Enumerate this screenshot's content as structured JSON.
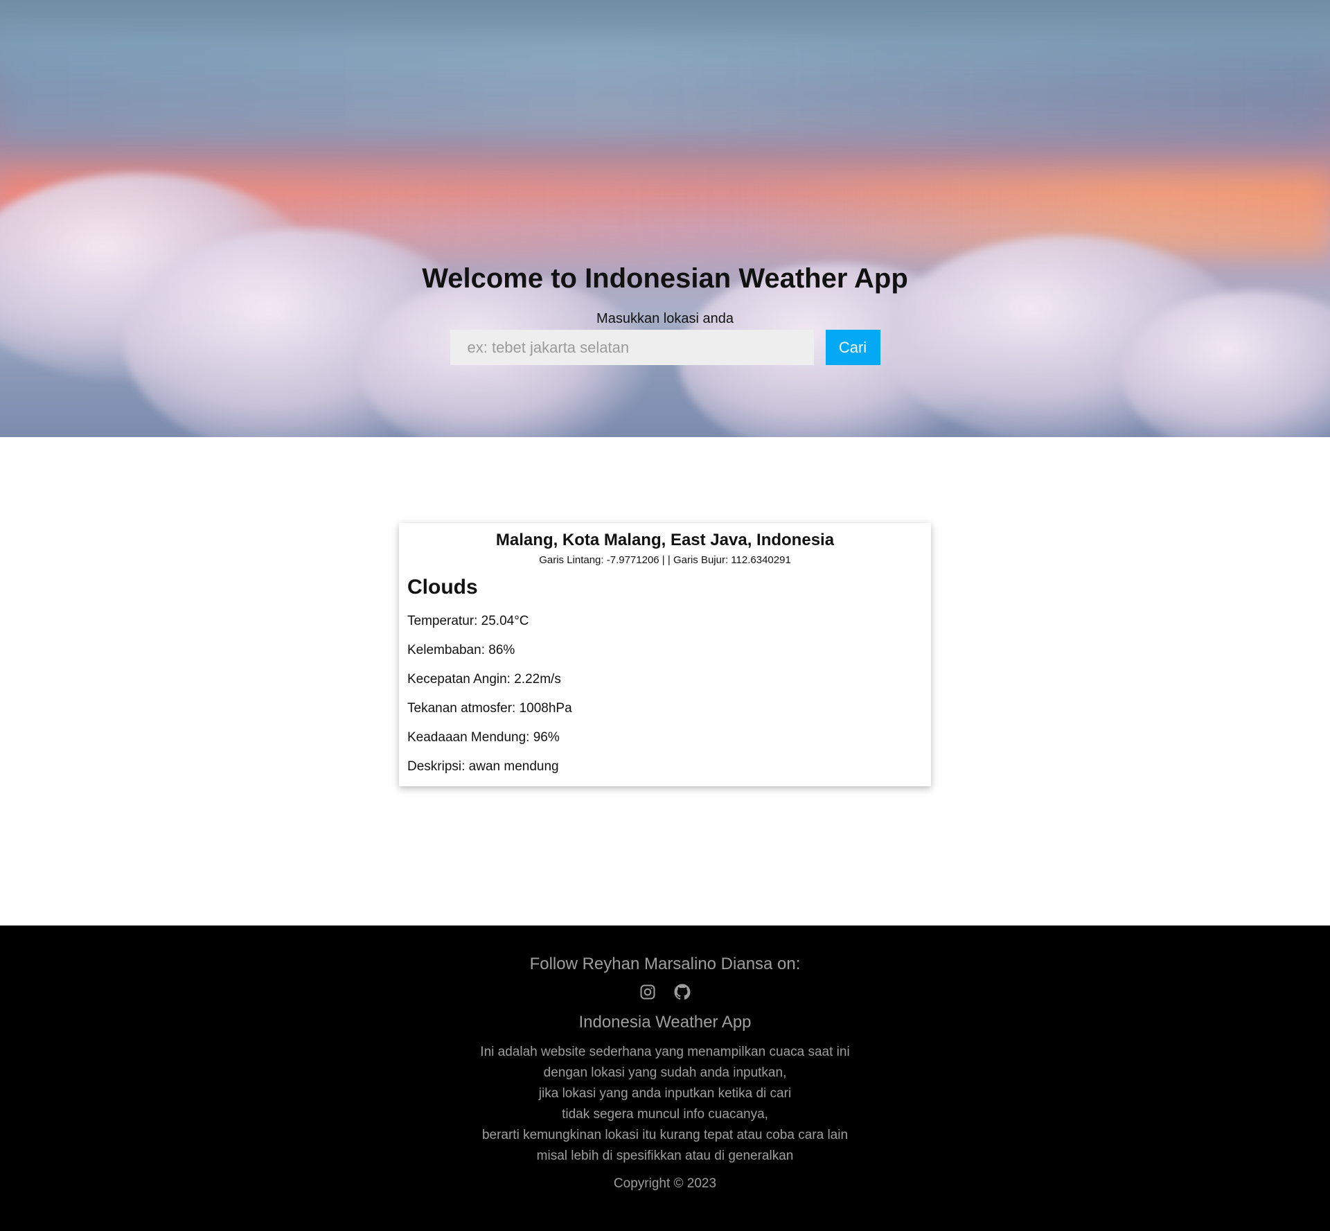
{
  "hero": {
    "title": "Welcome to Indonesian Weather App",
    "label": "Masukkan lokasi anda",
    "placeholder": "ex: tebet jakarta selatan",
    "button_label": "Cari"
  },
  "weather": {
    "location": "Malang, Kota Malang, East Java, Indonesia",
    "latitude_text": "Garis Lintang: -7.9771206 |",
    "longitude_text": "| Garis Bujur: 112.6340291",
    "condition": "Clouds",
    "rows": [
      "Temperatur: 25.04°C",
      "Kelembaban: 86%",
      "Kecepatan Angin: 2.22m/s",
      "Tekanan atmosfer: 1008hPa",
      "Keadaaan Mendung: 96%",
      "Deskripsi: awan mendung"
    ]
  },
  "footer": {
    "follow": "Follow Reyhan Marsalino Diansa on:",
    "icons": [
      "instagram-icon",
      "github-icon"
    ],
    "app_name": "Indonesia Weather App",
    "description": [
      "Ini adalah website sederhana yang menampilkan cuaca saat ini",
      "dengan lokasi yang sudah anda inputkan,",
      "jika lokasi yang anda inputkan ketika di cari",
      "tidak segera muncul info cuacanya,",
      "berarti kemungkinan lokasi itu kurang tepat atau coba cara lain",
      "misal lebih di spesifikkan atau di generalkan"
    ],
    "copyright": "Copyright © 2023"
  },
  "colors": {
    "accent": "#03a9f4",
    "footer_bg": "#000000",
    "footer_text": "#9e9e9e"
  }
}
